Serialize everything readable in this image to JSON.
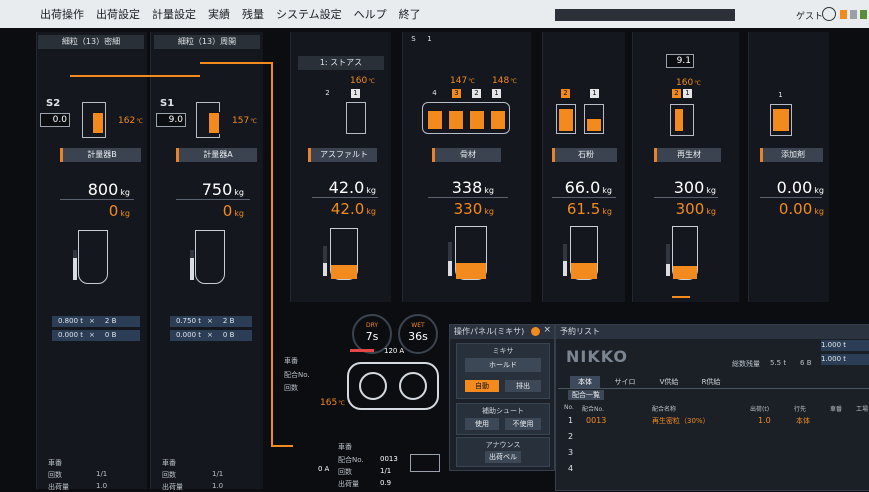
{
  "menu": [
    "出荷操作",
    "出荷設定",
    "計量設定",
    "実績",
    "残量",
    "システム設定",
    "ヘルプ",
    "終了"
  ],
  "user": "ゲスト",
  "silo_panels": [
    {
      "header": "細粒（13）密細",
      "silo_label": "S2",
      "silo_value": "0.0",
      "temp": "162",
      "temp_unit": "℃",
      "button": "計量器B",
      "target": "800",
      "actual": "0",
      "unit": "kg",
      "rows": [
        {
          "a": "0.800 t",
          "x": "×",
          "b": "2 B"
        },
        {
          "a": "0.000 t",
          "x": "×",
          "b": "0 B"
        }
      ],
      "level": 0.75
    },
    {
      "header": "細粒（13）周開",
      "silo_label": "S1",
      "silo_value": "9.0",
      "temp": "157",
      "temp_unit": "℃",
      "button": "計量器A",
      "target": "750",
      "actual": "0",
      "unit": "kg",
      "rows": [
        {
          "a": "0.750 t",
          "x": "×",
          "b": "2 B"
        },
        {
          "a": "0.000 t",
          "x": "×",
          "b": "0 B"
        }
      ],
      "level": 0.72
    }
  ],
  "material_panels": [
    {
      "header": "1: ストアス",
      "temp": "160",
      "bin_nums": [
        "2",
        "1"
      ],
      "button": "アスファルト",
      "target": "42.0",
      "actual": "42.0",
      "unit": "kg",
      "fill": 0.28,
      "level": 0.42
    },
    {
      "top_nums": [
        "S",
        "1"
      ],
      "temps": [
        "147",
        "148"
      ],
      "bin_nums": [
        "4",
        "3",
        "2",
        "1"
      ],
      "button": "骨材",
      "target": "338",
      "actual": "330",
      "unit": "kg",
      "fill": 0.3,
      "level": 0.45
    },
    {
      "bin_nums": [
        "2",
        "1"
      ],
      "button": "石粉",
      "target": "66.0",
      "actual": "61.5",
      "unit": "kg",
      "fill": 0.3,
      "level": 0.48
    },
    {
      "silo_value": "9.1",
      "temp": "160",
      "bin_nums": [
        "2",
        "1"
      ],
      "button": "再生材",
      "target": "300",
      "actual": "300",
      "unit": "kg",
      "fill": 0.25,
      "level": 0.38
    },
    {
      "bin_nums": [
        "1"
      ],
      "button": "添加剤",
      "target": "0.00",
      "actual": "0.00",
      "unit": "kg"
    }
  ],
  "mixer": {
    "dry_label": "DRY",
    "dry_value": "7s",
    "wet_label": "WET",
    "wet_value": "36s",
    "amp": "120",
    "amp_unit": "A",
    "temp": "165",
    "temp_unit": "℃"
  },
  "left_info": {
    "car": "車番",
    "lines": [
      {
        "k": "回数",
        "v": "1/1"
      },
      {
        "k": "出荷量",
        "v": "1.0"
      }
    ]
  },
  "mid_info": {
    "car": "車番",
    "keys": [
      "配合No.",
      "回数"
    ]
  },
  "dispatch_info": {
    "car": "車番",
    "rows": [
      {
        "k": "配合No.",
        "v": "0013"
      },
      {
        "k": "回数",
        "v": "1/1"
      },
      {
        "k": "出荷量",
        "v": "0.9"
      }
    ],
    "amp": "0",
    "amp_unit": "A"
  },
  "op_panel": {
    "title": "操作パネル(ミキサ)",
    "mixer_section": "ミキサ",
    "hold": "ホールド",
    "auto": "自動",
    "discharge": "排出",
    "chute_section": "補助シュート",
    "use": "使用",
    "unuse": "不使用",
    "announce_section": "アナウンス",
    "bell": "出荷ベル"
  },
  "reservation": {
    "title": "予約リスト",
    "logo": "NIKKO",
    "total_label": "総数残量",
    "total_value": "5.5",
    "total_unit": "t",
    "batch_value": "6",
    "batch_unit": "B",
    "right_vals": [
      "1.000 t",
      "1.000 t"
    ],
    "tabs": [
      "本体",
      "サイロ",
      "V供給",
      "R供給"
    ],
    "mix_list_btn": "配合一覧",
    "columns": [
      "No.",
      "配合No.",
      "配合名称",
      "出荷(t)",
      "行先",
      "車番",
      "工場"
    ],
    "rows": [
      {
        "no": "1",
        "mix_no": "0013",
        "name": "再生密粒（30%）",
        "qty": "1.0",
        "dest": "本体"
      },
      {
        "no": "2"
      },
      {
        "no": "3"
      },
      {
        "no": "4"
      }
    ]
  }
}
